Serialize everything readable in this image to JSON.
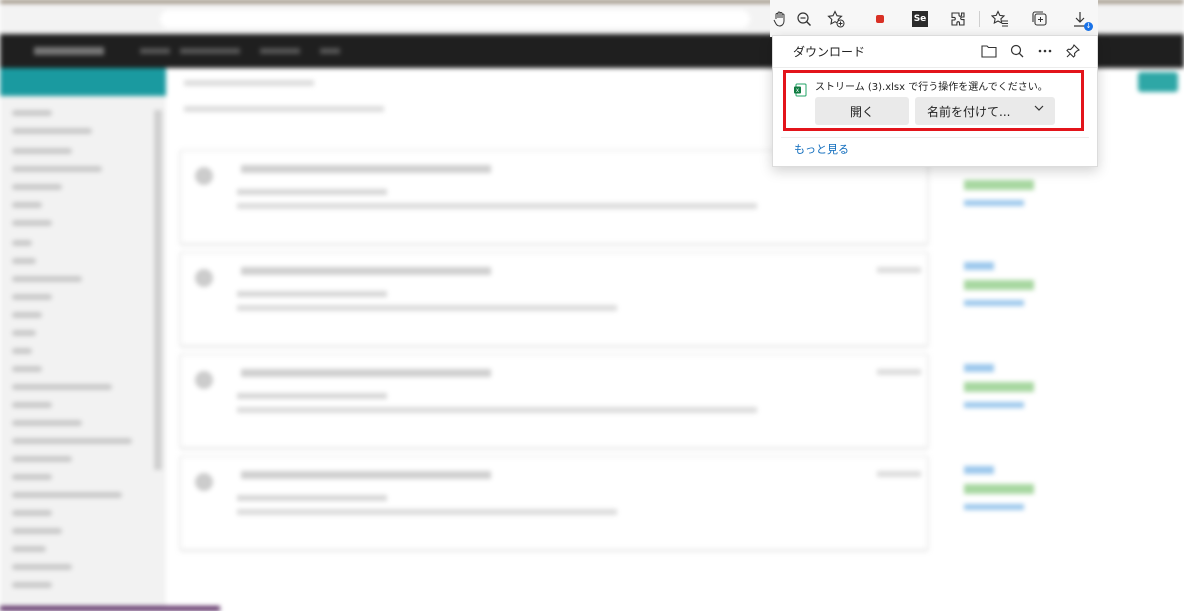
{
  "toolbar": {
    "icons": [
      "hand-icon",
      "zoom-out-icon",
      "favorite-add-icon",
      "extension-red-icon",
      "selenium-icon",
      "extensions-icon",
      "favorites-icon",
      "collections-icon",
      "downloads-icon"
    ],
    "selenium_label": "Se"
  },
  "downloads": {
    "title": "ダウンロード",
    "message": "ストリーム (3).xlsx で行う操作を選んでください。",
    "open_label": "開く",
    "saveas_label": "名前を付けて...",
    "more_label": "もっと見る",
    "highlight_color": "#e3141b",
    "link_color": "#0f6cbd"
  }
}
